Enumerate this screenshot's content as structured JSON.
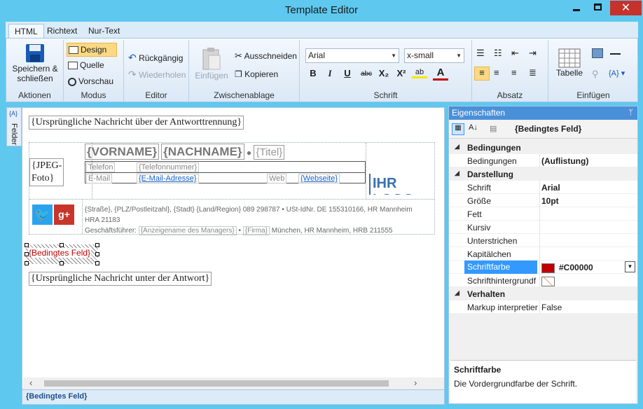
{
  "window": {
    "title": "Template Editor"
  },
  "tabs": [
    {
      "label": "HTML",
      "active": true
    },
    {
      "label": "Richtext"
    },
    {
      "label": "Nur-Text"
    }
  ],
  "ribbon": {
    "actions": {
      "save_label_1": "Speichern &",
      "save_label_2": "schließen",
      "group": "Aktionen"
    },
    "modus": {
      "design": "Design",
      "quelle": "Quelle",
      "vorschau": "Vorschau",
      "group": "Modus"
    },
    "editor": {
      "undo": "Rückgängig",
      "redo": "Wiederholen",
      "group": "Editor"
    },
    "clipboard": {
      "paste": "Einfügen",
      "cut": "Ausschneiden",
      "copy": "Kopieren",
      "group": "Zwischenablage"
    },
    "font": {
      "family": "Arial",
      "size": "x-small",
      "bold": "B",
      "italic": "I",
      "underline": "U",
      "strike": "abc",
      "sub": "X₂",
      "sup": "X²",
      "highlight": "ab",
      "color": "A",
      "group": "Schrift"
    },
    "paragraph": {
      "group": "Absatz"
    },
    "insert": {
      "table": "Tabelle",
      "group": "Einfügen"
    }
  },
  "side_panel": {
    "label": "Felder"
  },
  "document": {
    "top_text": "{Ursprüngliche Nachricht über der Antworttrennung}",
    "jpeg_line1": "{JPEG-",
    "jpeg_line2": "Foto}",
    "vorname": "{VORNAME}",
    "nachname": "{NACHNAME}",
    "titel": "{Titel}",
    "telefon_label": "Telefon",
    "telefon_value": "{Telefonnummer}",
    "email_label": "E-Mail",
    "email_value": "{E-Mail-Adresse}",
    "web_label": "Web",
    "web_value": "{Webseite}",
    "logo": "IHR LOGO",
    "address_1": "{Straße}, {PLZ/Postleitzahl}, {Stadt} {Land/Region} 089 298787 • USt-IdNr. DE 155310166, HR Mannheim",
    "address_2": "HRA 21183",
    "address_3a": "Geschäftsführer: ",
    "address_3b": "{Anzeigename des Managers}",
    "address_3c": " • ",
    "address_3d": "{Firma}",
    "address_3e": " München, HR Mannheim, HRB 211555",
    "conditional": "{Bedingtes Feld}",
    "bottom_text": "{Ursprüngliche Nachricht unter der Antwort}"
  },
  "status_bar": {
    "text": "{Bedingtes Feld}"
  },
  "properties": {
    "header": "Eigenschaften",
    "object": "{Bedingtes Feld}",
    "rows": [
      {
        "type": "cat",
        "name": "Bedingungen"
      },
      {
        "type": "prop",
        "name": "Bedingungen",
        "value": "(Auflistung)"
      },
      {
        "type": "cat",
        "name": "Darstellung"
      },
      {
        "type": "prop",
        "name": "Schrift",
        "value": "Arial"
      },
      {
        "type": "prop",
        "name": "Größe",
        "value": "10pt"
      },
      {
        "type": "prop",
        "name": "Fett",
        "value": ""
      },
      {
        "type": "prop",
        "name": "Kursiv",
        "value": ""
      },
      {
        "type": "prop",
        "name": "Unterstrichen",
        "value": ""
      },
      {
        "type": "prop",
        "name": "Kapitälchen",
        "value": ""
      },
      {
        "type": "prop",
        "name": "Schriftfarbe",
        "value": "#C00000",
        "selected": true
      },
      {
        "type": "prop",
        "name": "Schrifthintergrundf",
        "value": ""
      },
      {
        "type": "cat",
        "name": "Verhalten"
      },
      {
        "type": "prop",
        "name": "Markup interpretier",
        "value": "False"
      }
    ],
    "description_title": "Schriftfarbe",
    "description_text": "Die Vordergrundfarbe der Schrift."
  },
  "colors": {
    "accent": "#4a90d9",
    "font_color": "#C00000",
    "titlebar": "#5ec8ef"
  }
}
